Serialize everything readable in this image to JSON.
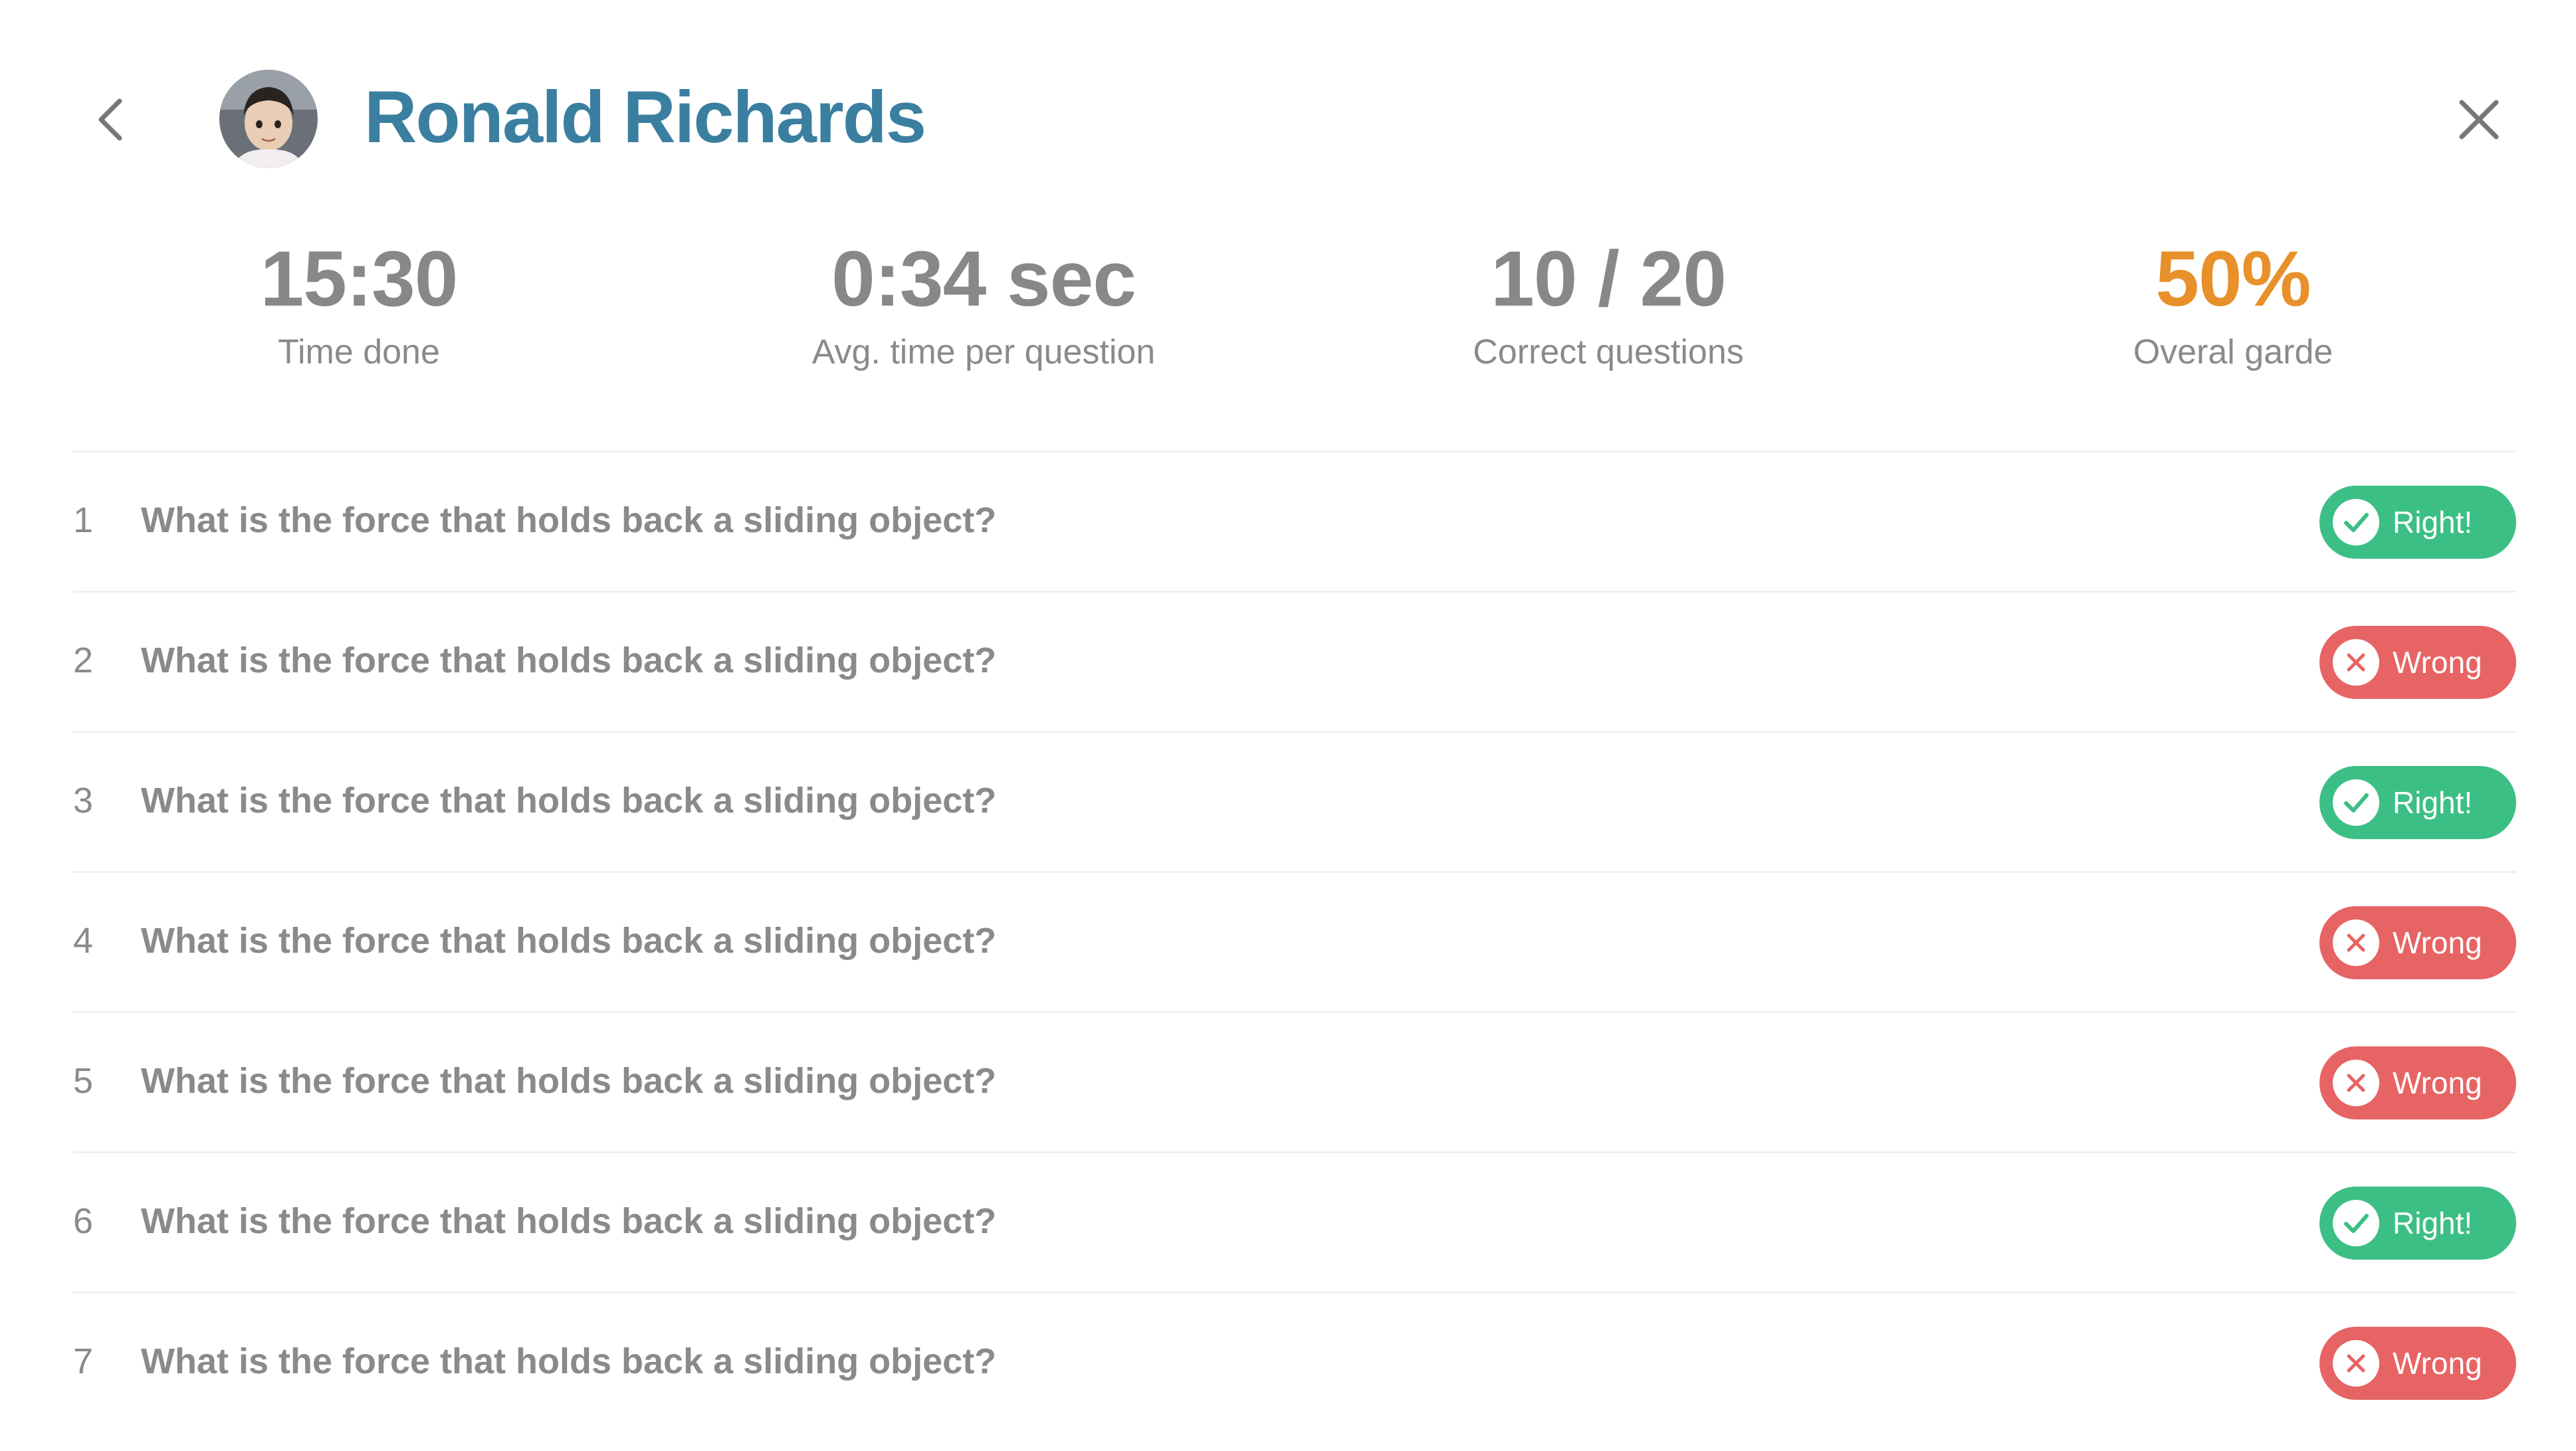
{
  "header": {
    "user_name": "Ronald Richards",
    "back_icon": "chevron-left-icon",
    "close_icon": "close-icon",
    "avatar_icon": "avatar-photo"
  },
  "stats": [
    {
      "value": "15:30",
      "label": "Time done"
    },
    {
      "value": "0:34 sec",
      "label": "Avg. time per question"
    },
    {
      "value": "10 / 20",
      "label": "Correct questions"
    },
    {
      "value": "50%",
      "label": "Overal garde"
    }
  ],
  "questions": [
    {
      "number": "1",
      "text": "What is the force that holds back a sliding object?",
      "result": "Right!",
      "status": "right"
    },
    {
      "number": "2",
      "text": "What is the force that holds back a sliding object?",
      "result": "Wrong",
      "status": "wrong"
    },
    {
      "number": "3",
      "text": "What is the force that holds back a sliding object?",
      "result": "Right!",
      "status": "right"
    },
    {
      "number": "4",
      "text": "What is the force that holds back a sliding object?",
      "result": "Wrong",
      "status": "wrong"
    },
    {
      "number": "5",
      "text": "What is the force that holds back a sliding object?",
      "result": "Wrong",
      "status": "wrong"
    },
    {
      "number": "6",
      "text": "What is the force that holds back a sliding object?",
      "result": "Right!",
      "status": "right"
    },
    {
      "number": "7",
      "text": "What is the force that holds back a sliding object?",
      "result": "Wrong",
      "status": "wrong"
    }
  ],
  "colors": {
    "name": "#3a7fa0",
    "accent": "#e8902a",
    "right": "#3cbf85",
    "wrong": "#e76464",
    "text": "#8a8a8a"
  }
}
